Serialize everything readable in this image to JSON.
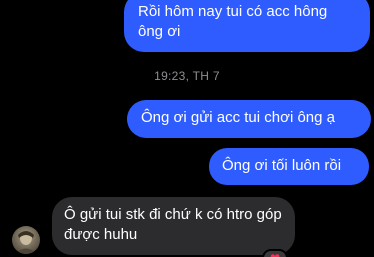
{
  "messages": [
    {
      "text": "Rồi hôm nay tui có acc hông ông ơi"
    },
    {
      "text": "Ông ơi gửi acc tui chơi ông ạ"
    },
    {
      "text": "Ông ơi tối luôn rồi"
    },
    {
      "text": "Ô gửi tui stk đi chứ k có htro góp được huhu"
    }
  ],
  "timestamp": "19:23, TH 7",
  "reaction": {
    "icon": "heart",
    "glyph": "❤"
  },
  "colors": {
    "outgoing_bubble": "#2f5cff",
    "incoming_bubble": "#2c2c2e",
    "background": "#000000"
  }
}
